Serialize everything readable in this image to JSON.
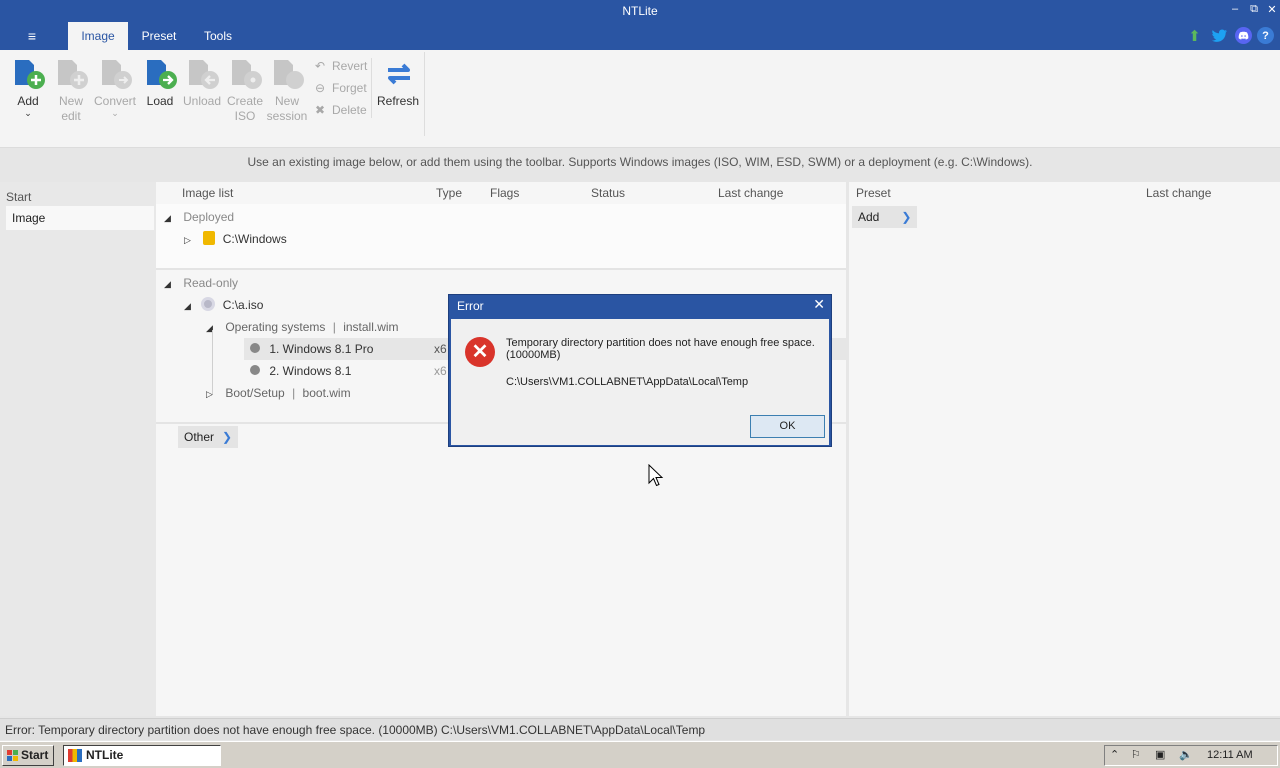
{
  "app": {
    "title": "NTLite"
  },
  "menu": {
    "icon": "hamburger-icon",
    "glyph": "≡"
  },
  "tabs": [
    {
      "label": "Image",
      "active": true
    },
    {
      "label": "Preset"
    },
    {
      "label": "Tools"
    }
  ],
  "window_controls": {
    "minimize": "–",
    "restore": "⧉",
    "close": "✕"
  },
  "top_icons": [
    {
      "name": "update-arrow-icon",
      "color": "#5cb85c"
    },
    {
      "name": "twitter-icon",
      "color": "#1da1f2"
    },
    {
      "name": "discord-icon",
      "color": "#5865f2"
    },
    {
      "name": "help-icon",
      "color": "#3a7bd5"
    }
  ],
  "ribbon": {
    "add": {
      "label": "Add"
    },
    "new_edit": {
      "line1": "New",
      "line2": "edit"
    },
    "convert": {
      "label": "Convert"
    },
    "load": {
      "label": "Load"
    },
    "unload": {
      "label": "Unload"
    },
    "create_iso": {
      "line1": "Create",
      "line2": "ISO"
    },
    "new_session": {
      "line1": "New",
      "line2": "session"
    },
    "revert": {
      "label": "Revert"
    },
    "forget": {
      "label": "Forget"
    },
    "delete": {
      "label": "Delete"
    },
    "refresh": {
      "label": "Refresh"
    }
  },
  "info_text": "Use an existing image below, or add them using the toolbar. Supports Windows images (ISO, WIM, ESD, SWM) or a deployment (e.g. C:\\Windows).",
  "left_panel": {
    "heading": "Start",
    "item": "Image"
  },
  "columns": {
    "image_list": "Image list",
    "type": "Type",
    "flags": "Flags",
    "status": "Status",
    "last_change": "Last change"
  },
  "tree": {
    "deployed": "Deployed",
    "deployed_item": "C:\\Windows",
    "read_only": "Read-only",
    "iso": "C:\\a.iso",
    "os_group": "Operating systems",
    "os_file": "install.wim",
    "os1": "1. Windows 8.1 Pro",
    "os2": "2. Windows 8.1",
    "os_type_partial": "x6",
    "boot_group": "Boot/Setup",
    "boot_file": "boot.wim",
    "pipe": "|",
    "other": "Other"
  },
  "right_panel": {
    "preset": "Preset",
    "last_change": "Last change",
    "add": "Add"
  },
  "dialog": {
    "title": "Error",
    "message": "Temporary directory partition does not have enough free space. (10000MB)",
    "path": "C:\\Users\\VM1.COLLABNET\\AppData\\Local\\Temp",
    "ok": "OK"
  },
  "status_bar": "Error: Temporary directory partition does not have enough free space. (10000MB)  C:\\Users\\VM1.COLLABNET\\AppData\\Local\\Temp",
  "taskbar": {
    "start": "Start",
    "app": "NTLite",
    "clock": "12:11 AM"
  }
}
